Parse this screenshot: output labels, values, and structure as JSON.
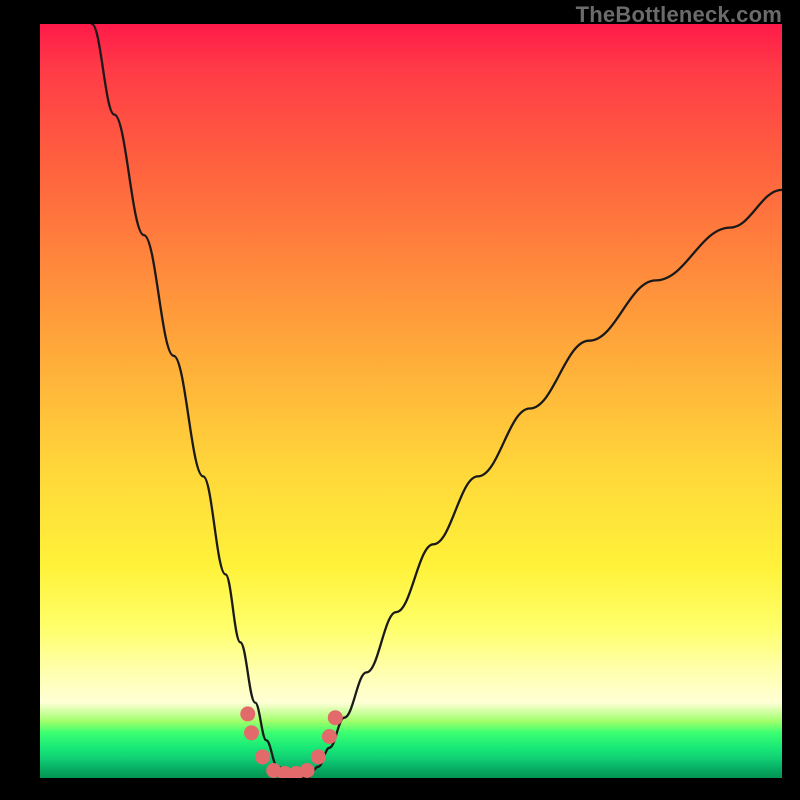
{
  "watermark": "TheBottleneck.com",
  "colors": {
    "background": "#000000",
    "curve_stroke": "#1a1a1a",
    "dot_fill": "#e36a6a",
    "gradient_top": "#ff1a49",
    "gradient_bottom": "#039452"
  },
  "chart_data": {
    "type": "line",
    "title": "",
    "xlabel": "",
    "ylabel": "",
    "xlim": [
      0,
      100
    ],
    "ylim": [
      0,
      100
    ],
    "grid": false,
    "legend": false,
    "note": "Axes are unlabeled in the image; x and y values are estimated from pixel positions on a 0–100 scale. The curve is a V-shaped bottleneck profile with its trough near x≈31–37, y≈0.",
    "series": [
      {
        "name": "bottleneck-curve",
        "x": [
          7,
          10,
          14,
          18,
          22,
          25,
          27,
          29,
          30.5,
          32,
          34,
          36,
          37.5,
          39,
          41,
          44,
          48,
          53,
          59,
          66,
          74,
          83,
          93,
          100
        ],
        "y": [
          100,
          88,
          72,
          56,
          40,
          27,
          18,
          10,
          5,
          1.5,
          0,
          0,
          1.5,
          4,
          8,
          14,
          22,
          31,
          40,
          49,
          58,
          66,
          73,
          78
        ]
      }
    ],
    "dots": {
      "name": "trough-dots",
      "note": "Pink dots clustered at the bottom of the V. Coordinates on same 0–100 scale.",
      "points": [
        {
          "x": 28.0,
          "y": 8.5
        },
        {
          "x": 28.5,
          "y": 6.0
        },
        {
          "x": 30.0,
          "y": 2.8
        },
        {
          "x": 31.5,
          "y": 1.0
        },
        {
          "x": 33.0,
          "y": 0.6
        },
        {
          "x": 34.5,
          "y": 0.6
        },
        {
          "x": 36.0,
          "y": 1.0
        },
        {
          "x": 37.5,
          "y": 2.8
        },
        {
          "x": 39.0,
          "y": 5.5
        },
        {
          "x": 39.8,
          "y": 8.0
        }
      ]
    }
  }
}
